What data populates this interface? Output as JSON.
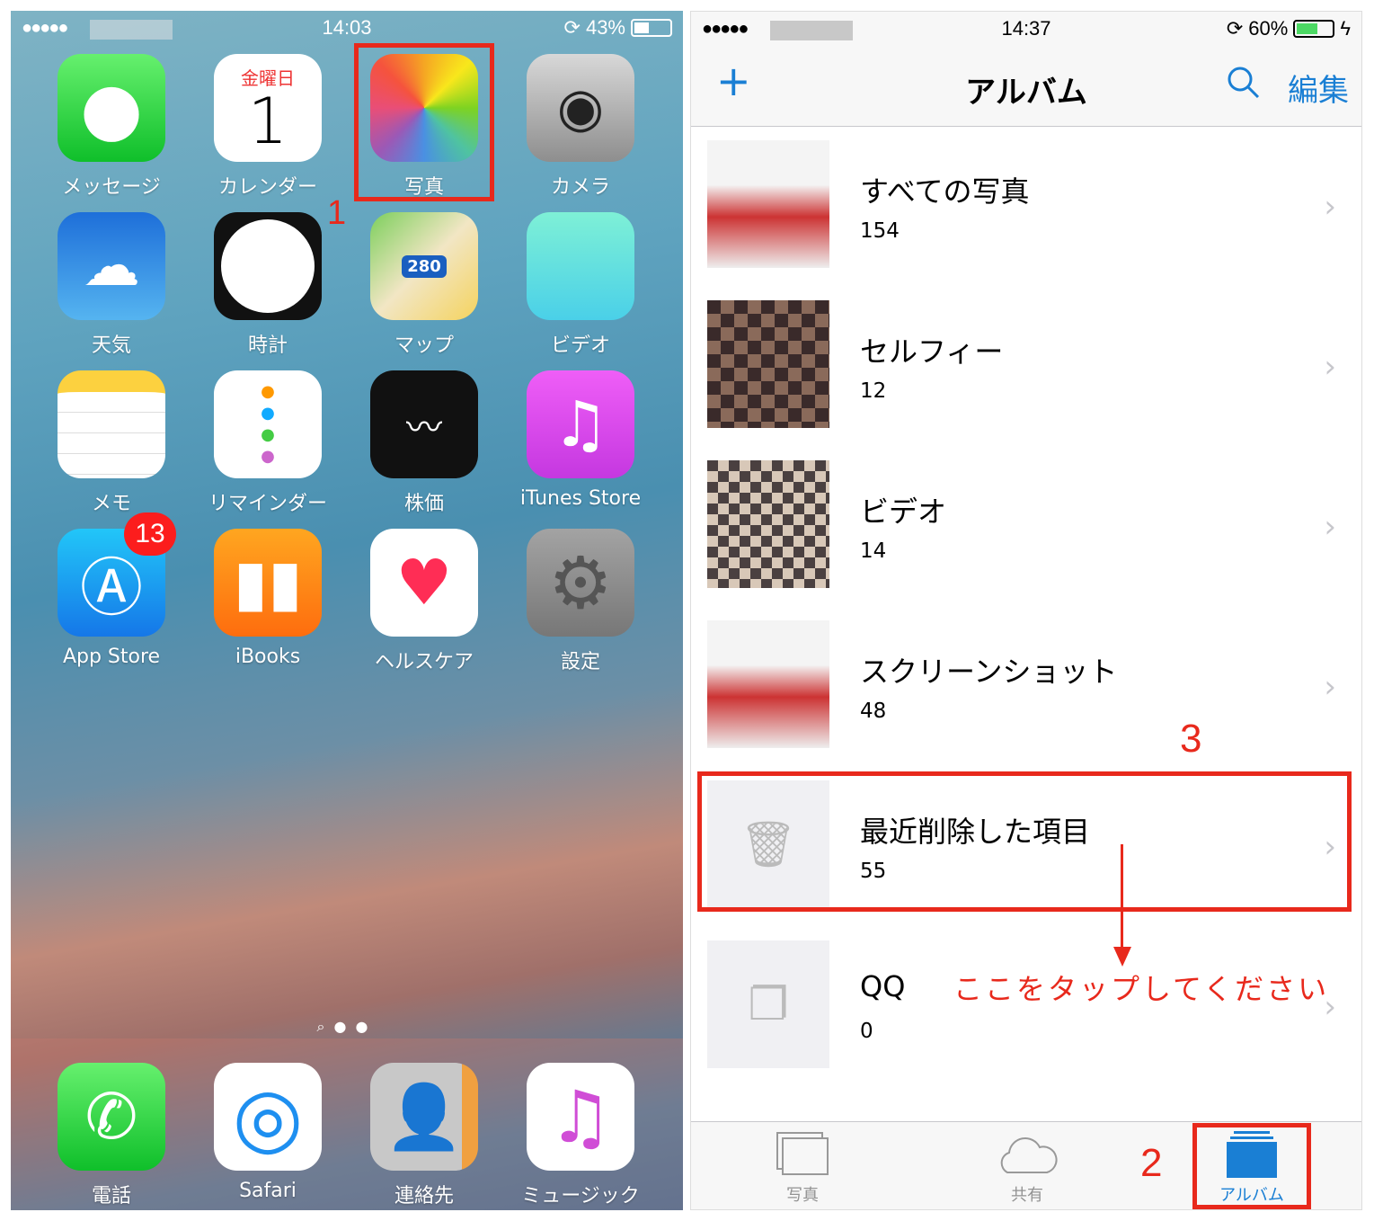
{
  "left": {
    "status": {
      "signal": "●●●●●",
      "time": "14:03",
      "battery": "43%",
      "battery_level": 0.43
    },
    "apps": [
      {
        "label": "メッセージ",
        "icon": "messages-icon"
      },
      {
        "label": "カレンダー",
        "icon": "calendar-icon",
        "day": "金曜日",
        "date": "1"
      },
      {
        "label": "写真",
        "icon": "photos-icon"
      },
      {
        "label": "カメラ",
        "icon": "camera-icon"
      },
      {
        "label": "天気",
        "icon": "weather-icon"
      },
      {
        "label": "時計",
        "icon": "clock-icon"
      },
      {
        "label": "マップ",
        "icon": "maps-icon",
        "sign": "280"
      },
      {
        "label": "ビデオ",
        "icon": "video-icon"
      },
      {
        "label": "メモ",
        "icon": "notes-icon"
      },
      {
        "label": "リマインダー",
        "icon": "reminders-icon"
      },
      {
        "label": "株価",
        "icon": "stocks-icon"
      },
      {
        "label": "iTunes Store",
        "icon": "itunes-icon"
      },
      {
        "label": "App Store",
        "icon": "appstore-icon",
        "badge": "13"
      },
      {
        "label": "iBooks",
        "icon": "ibooks-icon"
      },
      {
        "label": "ヘルスケア",
        "icon": "health-icon"
      },
      {
        "label": "設定",
        "icon": "settings-icon"
      }
    ],
    "dock": [
      {
        "label": "電話",
        "icon": "phone-icon"
      },
      {
        "label": "Safari",
        "icon": "safari-icon"
      },
      {
        "label": "連絡先",
        "icon": "contacts-icon"
      },
      {
        "label": "ミュージック",
        "icon": "music-icon"
      }
    ],
    "step": "1"
  },
  "right": {
    "status": {
      "signal": "●●●●●",
      "time": "14:37",
      "battery": "60%",
      "battery_level": 0.6
    },
    "nav": {
      "add": "+",
      "title": "アルバム",
      "edit": "編集"
    },
    "albums": [
      {
        "title": "すべての写真",
        "count": "154"
      },
      {
        "title": "セルフィー",
        "count": "12"
      },
      {
        "title": "ビデオ",
        "count": "14"
      },
      {
        "title": "スクリーンショット",
        "count": "48"
      },
      {
        "title": "最近削除した項目",
        "count": "55"
      },
      {
        "title": "QQ",
        "count": "0"
      }
    ],
    "tabs": [
      {
        "label": "写真"
      },
      {
        "label": "共有"
      },
      {
        "label": "アルバム",
        "active": true
      }
    ],
    "step2": "2",
    "step3": "3",
    "instruction": "ここをタップしてください",
    "accent": "#1a7fd4",
    "annotation_color": "#e8291c"
  }
}
